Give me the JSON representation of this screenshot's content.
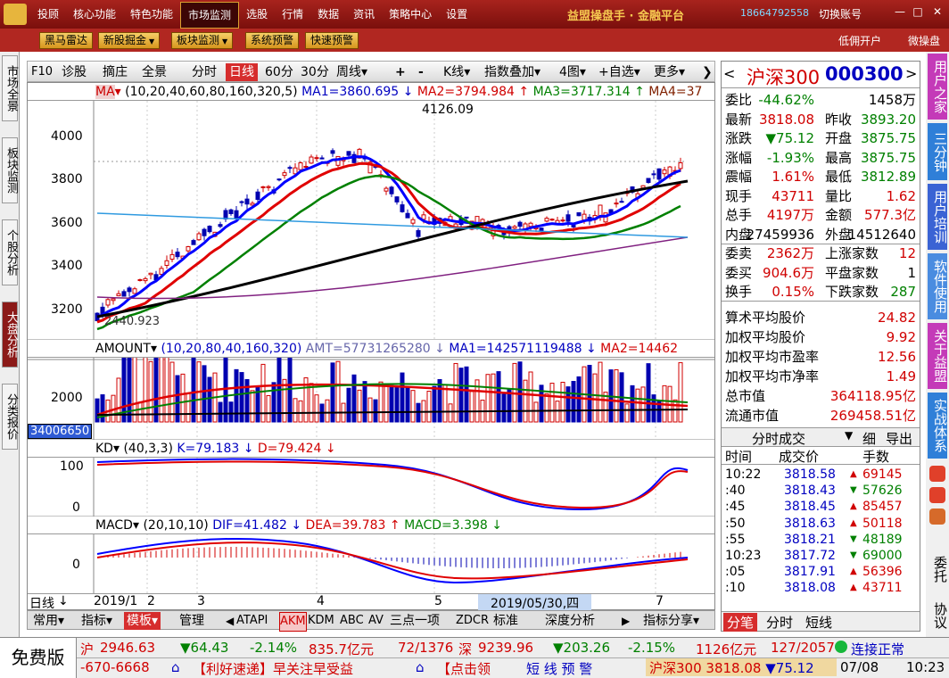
{
  "topbar": {
    "menu": [
      "投顾",
      "核心功能",
      "特色功能",
      "市场监测",
      "选股",
      "行情",
      "数据",
      "资讯",
      "策略中心",
      "设置"
    ],
    "active_menu": "市场监测",
    "app_title": "益盟操盘手 · 金融平台",
    "phone": "18664792558",
    "switch_account": "切换账号"
  },
  "toolbar2": {
    "buttons": [
      "黑马雷达",
      "新股掘金",
      "板块监测",
      "系统预警",
      "快速预警"
    ],
    "right_links": [
      "低佣开户",
      "微操盘"
    ]
  },
  "left_tabs": [
    "市场全景",
    "板块监测",
    "个股分析",
    "大盘分析",
    "分类报价"
  ],
  "left_active": "大盘分析",
  "chart_toolbar": {
    "items": [
      "F10",
      "诊股",
      "摘庄",
      "全景",
      "分时",
      "日线",
      "60分",
      "30分",
      "周线",
      "+",
      "-",
      "K线",
      "指数叠加",
      "4图",
      "自选",
      "更多"
    ],
    "active": "日线"
  },
  "main_panel": {
    "header": [
      "MA",
      "(10,20,40,60,80,160,320,5)",
      "MA1=3860.695 ↓",
      "MA2=3794.984 ↑",
      "MA3=3717.314 ↑",
      "MA4=37"
    ],
    "y_ticks": [
      "4000",
      "3800",
      "3600",
      "3400",
      "3200"
    ],
    "high_label": "4126.09",
    "low_label": "2440.923"
  },
  "amount_panel": {
    "header": [
      "AMOUNT",
      "(10,20,80,40,160,320)",
      "AMT=57731265280 ↓",
      "MA1=142571119488 ↓",
      "MA2=14462"
    ],
    "y_ticks": [
      "2000"
    ],
    "value_box": "34006650"
  },
  "kd_panel": {
    "header": [
      "KD",
      "(40,3,3)",
      "K=79.183 ↓",
      "D=79.424 ↓"
    ],
    "y_ticks": [
      "100",
      "0"
    ]
  },
  "macd_panel": {
    "header": [
      "MACD",
      "(20,10,10)",
      "DIF=41.482 ↓",
      "DEA=39.783 ↑",
      "MACD=3.398 ↓"
    ],
    "y_ticks": [
      "0"
    ]
  },
  "x_axis": {
    "labels": [
      "日线",
      "2019/1",
      "2",
      "3",
      "4",
      "5",
      "7"
    ],
    "cursor_date": "2019/05/30,四"
  },
  "bottom_tabs": [
    "常用",
    "指标",
    "模板",
    "管理",
    "ATAPI",
    "AKM",
    "KDM",
    "ABC",
    "AV",
    "三点一项",
    "ZDCR",
    "标准",
    "深度分析",
    "指标分享"
  ],
  "bottom_active": "模板",
  "quote": {
    "name": "沪深300",
    "code": "000300",
    "rows": [
      [
        "委比",
        "-44.62%",
        "",
        "1458万"
      ],
      [
        "最新",
        "3818.08",
        "昨收",
        "3893.20"
      ],
      [
        "涨跌",
        "▼75.12",
        "开盘",
        "3875.75"
      ],
      [
        "涨幅",
        "-1.93%",
        "最高",
        "3875.75"
      ],
      [
        "震幅",
        "1.61%",
        "最低",
        "3812.89"
      ],
      [
        "现手",
        "43711",
        "量比",
        "1.62"
      ],
      [
        "总手",
        "4197万",
        "金额",
        "577.3亿"
      ],
      [
        "内盘",
        "27459936",
        "外盘",
        "14512640"
      ],
      [
        "委卖",
        "2362万",
        "上涨家数",
        "12"
      ],
      [
        "委买",
        "904.6万",
        "平盘家数",
        "1"
      ],
      [
        "换手",
        "0.15%",
        "下跌家数",
        "287"
      ]
    ],
    "stats": [
      [
        "算术平均股价",
        "24.82"
      ],
      [
        "加权平均股价",
        "9.92"
      ],
      [
        "加权平均市盈率",
        "12.56"
      ],
      [
        "加权平均市净率",
        "1.49"
      ],
      [
        "总市值",
        "364118.95亿"
      ],
      [
        "流通市值",
        "269458.51亿"
      ]
    ],
    "trade_tabs": [
      "分时成交",
      "细",
      "导出"
    ],
    "trade_headers": [
      "时间",
      "成交价",
      "手数"
    ],
    "trades": [
      [
        "10:22",
        "3818.58",
        "▲",
        "69145"
      ],
      [
        ":40",
        "3818.43",
        "▼",
        "57626"
      ],
      [
        ":45",
        "3818.45",
        "▲",
        "85457"
      ],
      [
        ":50",
        "3818.63",
        "▲",
        "50118"
      ],
      [
        ":55",
        "3818.21",
        "▼",
        "48189"
      ],
      [
        "10:23",
        "3817.72",
        "▼",
        "69000"
      ],
      [
        ":05",
        "3817.91",
        "▲",
        "56396"
      ],
      [
        ":10",
        "3818.08",
        "▲",
        "43711"
      ]
    ],
    "bottom_tabs": [
      "分笔",
      "分时",
      "短线"
    ]
  },
  "right_side": [
    "用户之家",
    "三分钟",
    "用户培训",
    "软件使用",
    "关于益盟",
    "实战体系",
    "委托",
    "协议"
  ],
  "status": {
    "free": "免费版",
    "sh_label": "沪",
    "sh_value": "2946.63",
    "sh_change": "▼64.43",
    "sh_pct": "-2.14%",
    "sh_amt": "835.7亿元",
    "sh_ratio": "72/1376",
    "sz_label": "深",
    "sz_value": "9239.96",
    "sz_change": "▼203.26",
    "sz_pct": "-2.15%",
    "sz_amt": "1126亿元",
    "sz_ratio": "127/2057",
    "conn": "连接正常",
    "phone2": "-670-6668",
    "news1": "【利好速递】早关注早受益",
    "news2": "【点击领",
    "alert": "短 线 预 警",
    "ticker": "沪深300",
    "ticker_val": "3818.08",
    "ticker_chg": "▼75.12",
    "date": "07/08",
    "time": "10:23"
  },
  "colors": {
    "brand_red": "#a8231d",
    "gold": "#f6c850",
    "up": "#d00000",
    "down": "#008000"
  }
}
